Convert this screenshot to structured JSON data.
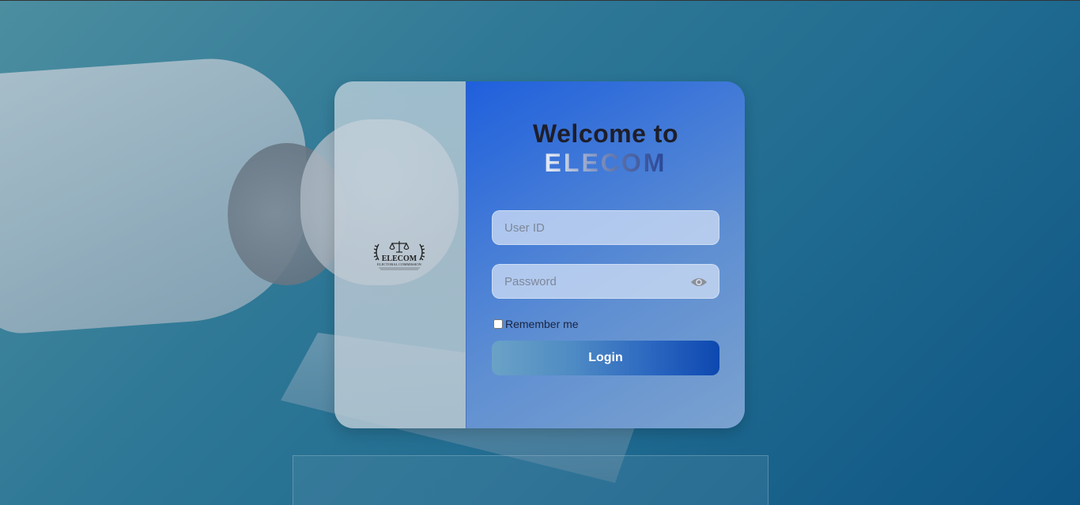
{
  "login": {
    "welcome_line": "Welcome to",
    "brand": "ELECOM",
    "user_id_placeholder": "User ID",
    "password_placeholder": "Password",
    "remember_label": "Remember me",
    "login_button": "Login"
  },
  "logo": {
    "name": "ELECOM",
    "subtitle": "ELECTORAL COMMISSION"
  },
  "icons": {
    "password_toggle": "eye-icon",
    "logo_emblem": "scales-of-justice-icon"
  },
  "colors": {
    "accent": "#1f5fdc",
    "button_end": "#0d48b0",
    "background": "#1f6a90"
  }
}
